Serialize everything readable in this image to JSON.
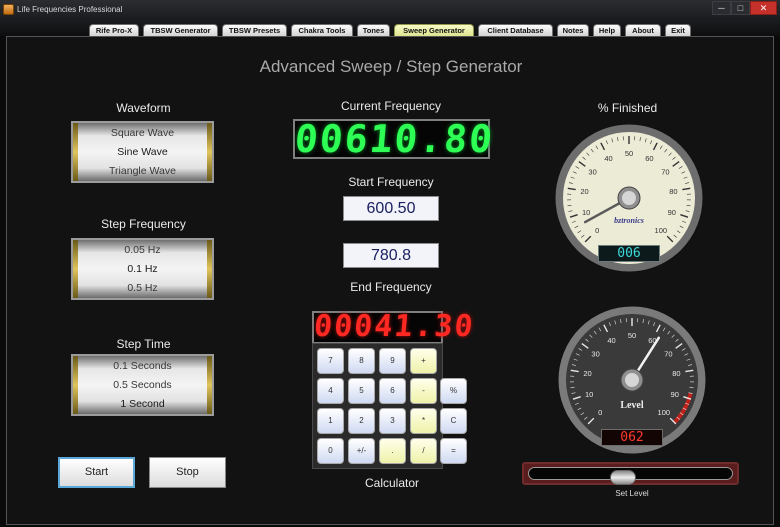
{
  "window": {
    "title": "Life Frequencies Professional",
    "minimize": "─",
    "maximize": "□",
    "close": "✕"
  },
  "tabs": [
    {
      "label": "Rife Pro-X",
      "active": false
    },
    {
      "label": "TBSW Generator",
      "active": false
    },
    {
      "label": "TBSW Presets",
      "active": false
    },
    {
      "label": "Chakra Tools",
      "active": false
    },
    {
      "label": "Tones",
      "active": false
    },
    {
      "label": "Sweep Generator",
      "active": true
    },
    {
      "label": "Client Database",
      "active": false
    },
    {
      "label": "Notes",
      "active": false
    },
    {
      "label": "Help",
      "active": false
    },
    {
      "label": "About",
      "active": false
    },
    {
      "label": "Exit",
      "active": false
    }
  ],
  "page": {
    "heading": "Advanced Sweep / Step Generator"
  },
  "waveform": {
    "label": "Waveform",
    "options": [
      "Square Wave",
      "Sine Wave",
      "Triangle Wave"
    ],
    "selected": "Sine Wave"
  },
  "step_frequency": {
    "label": "Step Frequency",
    "options": [
      "0.05 Hz",
      "0.1 Hz",
      "0.5 Hz"
    ],
    "selected": "0.1 Hz"
  },
  "step_time": {
    "label": "Step Time",
    "options": [
      "0.1 Seconds",
      "0.5 Seconds",
      "1 Second"
    ],
    "selected": "1 Second"
  },
  "current_frequency": {
    "label": "Current Frequency",
    "display": "00610.80"
  },
  "start_frequency": {
    "label": "Start Frequency",
    "value": "600.50"
  },
  "end_frequency": {
    "label": "End Frequency",
    "value": "780.8"
  },
  "calculator": {
    "label": "Calculator",
    "display": "00041.30",
    "keys": [
      {
        "label": "7",
        "kind": "num"
      },
      {
        "label": "8",
        "kind": "num"
      },
      {
        "label": "9",
        "kind": "num"
      },
      {
        "label": "+",
        "kind": "op"
      },
      {
        "label": "4",
        "kind": "num"
      },
      {
        "label": "5",
        "kind": "num"
      },
      {
        "label": "6",
        "kind": "num"
      },
      {
        "label": "-",
        "kind": "op"
      },
      {
        "label": "%",
        "kind": "num"
      },
      {
        "label": "1",
        "kind": "num"
      },
      {
        "label": "2",
        "kind": "num"
      },
      {
        "label": "3",
        "kind": "num"
      },
      {
        "label": "*",
        "kind": "op"
      },
      {
        "label": "C",
        "kind": "num"
      },
      {
        "label": "0",
        "kind": "num"
      },
      {
        "label": "+/-",
        "kind": "num"
      },
      {
        "label": ".",
        "kind": "op"
      },
      {
        "label": "/",
        "kind": "op"
      },
      {
        "label": "=",
        "kind": "num"
      }
    ]
  },
  "percent_finished": {
    "label": "% Finished",
    "value": 6,
    "readout": "006",
    "brand": "bztronics",
    "ticks": [
      "0",
      "10",
      "20",
      "30",
      "40",
      "50",
      "60",
      "70",
      "80",
      "90",
      "100"
    ]
  },
  "level": {
    "label": "Level",
    "value": 62,
    "readout": "062",
    "ticks": [
      "0",
      "10",
      "20",
      "30",
      "40",
      "50",
      "60",
      "70",
      "80",
      "90",
      "100"
    ]
  },
  "set_level": {
    "label": "Set Level",
    "value": 0.46
  },
  "buttons": {
    "start": "Start",
    "stop": "Stop"
  },
  "colors": {
    "led_green": "#2dff55",
    "led_red": "#ff2822",
    "gauge_face_light": "#ecebd6",
    "gauge_face_dark": "#3a3a3a",
    "active_tab": "#dbe28a",
    "needle": "#ff6a00"
  }
}
